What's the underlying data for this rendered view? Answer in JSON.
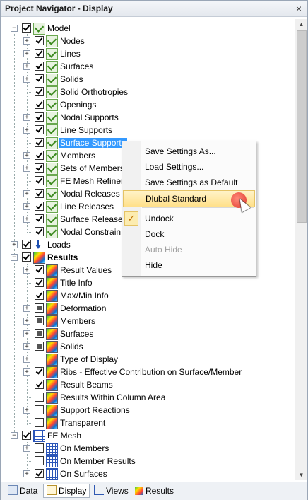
{
  "window": {
    "title": "Project Navigator - Display",
    "close_glyph": "×"
  },
  "tree": {
    "model": {
      "label": "Model"
    },
    "model_items": [
      "Nodes",
      "Lines",
      "Surfaces",
      "Solids",
      "Solid Orthotropies",
      "Openings",
      "Nodal Supports",
      "Line Supports",
      "Surface Supports",
      "Members",
      "Sets of Members",
      "FE Mesh Refinen",
      "Nodal Releases",
      "Line Releases",
      "Surface Releases",
      "Nodal Constrain"
    ],
    "loads": {
      "label": "Loads"
    },
    "results": {
      "label": "Results"
    },
    "results_items": [
      "Result Values",
      "Title Info",
      "Max/Min Info",
      "Deformation",
      "Members",
      "Surfaces",
      "Solids",
      "Type of Display",
      "Ribs - Effective Contribution on Surface/Member",
      "Result Beams",
      "Results Within Column Area",
      "Support Reactions",
      "Transparent"
    ],
    "fe_mesh": {
      "label": "FE Mesh"
    },
    "fe_items": [
      "On Members",
      "On Member Results",
      "On Surfaces"
    ]
  },
  "context_menu": {
    "items": [
      "Save Settings As...",
      "Load Settings...",
      "Save Settings as Default",
      "Dlubal Standard",
      "Undock",
      "Dock",
      "Auto Hide",
      "Hide"
    ]
  },
  "tabs": [
    "Data",
    "Display",
    "Views",
    "Results"
  ],
  "colors": {
    "accent": "#3399ff",
    "highlight": "#ffe08a",
    "cursor": "#e0392b"
  }
}
